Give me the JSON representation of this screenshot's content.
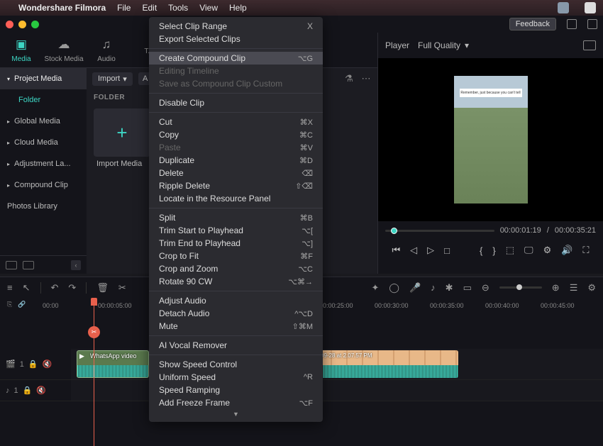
{
  "menubar": {
    "app_name": "Wondershare Filmora",
    "items": [
      "File",
      "Edit",
      "Tools",
      "View",
      "Help"
    ]
  },
  "chrome": {
    "feedback": "Feedback"
  },
  "top_tabs": {
    "media": "Media",
    "stock": "Stock Media",
    "audio": "Audio",
    "more": "T..."
  },
  "sidebar": {
    "project": "Project Media",
    "folder": "Folder",
    "global": "Global Media",
    "cloud": "Cloud Media",
    "adjust": "Adjustment La...",
    "compound": "Compound Clip",
    "photos": "Photos Library"
  },
  "media_panel": {
    "import": "Import",
    "folder_label": "FOLDER",
    "import_tile": "Import Media"
  },
  "player": {
    "title": "Player",
    "quality": "Full Quality",
    "caption": "Remember, just because you can't tell",
    "current": "00:00:01:19",
    "sep": "/",
    "total": "00:00:35:21"
  },
  "ruler": {
    "ticks": [
      "00:00",
      "00:00:05:00",
      "",
      "",
      "",
      "00:00:25:00",
      "00:00:30:00",
      "00:00:35:00",
      "00:00:40:00",
      "00:00:45:00"
    ]
  },
  "tracks": {
    "v1": "1",
    "a1": "1",
    "clip1_label": "WhatsApp video",
    "clip2_ts": "09-28 at 2.07.57 PM"
  },
  "context_menu": {
    "select_clip_range": "Select Clip Range",
    "x": "X",
    "export_selected": "Export Selected Clips",
    "create_compound": "Create Compound Clip",
    "create_compound_sc": "⌥G",
    "editing_timeline": "Editing Timeline",
    "save_as_compound": "Save as Compound Clip Custom",
    "disable_clip": "Disable Clip",
    "cut": "Cut",
    "cut_sc": "⌘X",
    "copy": "Copy",
    "copy_sc": "⌘C",
    "paste": "Paste",
    "paste_sc": "⌘V",
    "duplicate": "Duplicate",
    "duplicate_sc": "⌘D",
    "delete": "Delete",
    "delete_sc": "⌫",
    "ripple_delete": "Ripple Delete",
    "ripple_delete_sc": "⇧⌫",
    "locate": "Locate in the Resource Panel",
    "split": "Split",
    "split_sc": "⌘B",
    "trim_start": "Trim Start to Playhead",
    "trim_start_sc": "⌥[",
    "trim_end": "Trim End to Playhead",
    "trim_end_sc": "⌥]",
    "crop_fit": "Crop to Fit",
    "crop_fit_sc": "⌘F",
    "crop_zoom": "Crop and Zoom",
    "crop_zoom_sc": "⌥C",
    "rotate": "Rotate 90 CW",
    "rotate_sc": "⌥⌘→",
    "adjust_audio": "Adjust Audio",
    "detach_audio": "Detach Audio",
    "detach_audio_sc": "^⌥D",
    "mute": "Mute",
    "mute_sc": "⇧⌘M",
    "ai_vocal": "AI Vocal Remover",
    "speed_ctrl": "Show Speed Control",
    "uniform_speed": "Uniform Speed",
    "uniform_speed_sc": "^R",
    "speed_ramp": "Speed Ramping",
    "freeze": "Add Freeze Frame",
    "freeze_sc": "⌥F"
  }
}
